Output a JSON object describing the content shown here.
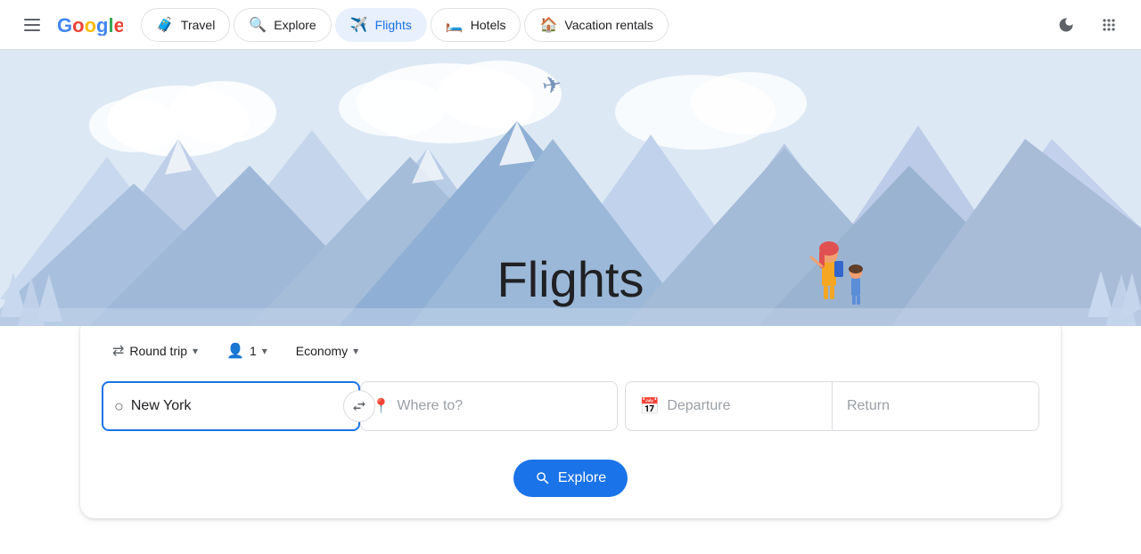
{
  "navbar": {
    "tabs": [
      {
        "id": "travel",
        "label": "Travel",
        "icon": "🧳",
        "active": false
      },
      {
        "id": "explore",
        "label": "Explore",
        "icon": "🔍",
        "active": false
      },
      {
        "id": "flights",
        "label": "Flights",
        "icon": "✈️",
        "active": true
      },
      {
        "id": "hotels",
        "label": "Hotels",
        "icon": "🛏️",
        "active": false
      },
      {
        "id": "vacation",
        "label": "Vacation rentals",
        "icon": "🏠",
        "active": false
      }
    ]
  },
  "hero": {
    "title": "Flights"
  },
  "search": {
    "trip_type": "Round trip",
    "passengers": "1",
    "cabin_class": "Economy",
    "origin_placeholder": "New York",
    "destination_placeholder": "Where to?",
    "departure_placeholder": "Departure",
    "return_placeholder": "Return",
    "explore_label": "Explore"
  }
}
